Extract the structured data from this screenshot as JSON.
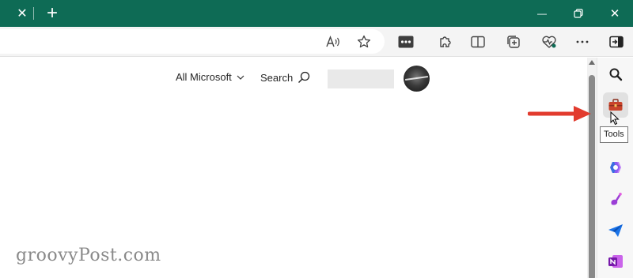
{
  "window": {
    "close_tab_glyph": "✕",
    "new_tab_glyph": "+",
    "minimize_glyph": "—",
    "close_glyph": "✕"
  },
  "page": {
    "all_microsoft": "All Microsoft",
    "search": "Search",
    "watermark": "groovyPost.com"
  },
  "sidebar": {
    "tooltip": "Tools"
  },
  "colors": {
    "titlebar": "#0e6b55",
    "annotation_arrow": "#e23b2e",
    "tools_icon": "#c8432b"
  }
}
